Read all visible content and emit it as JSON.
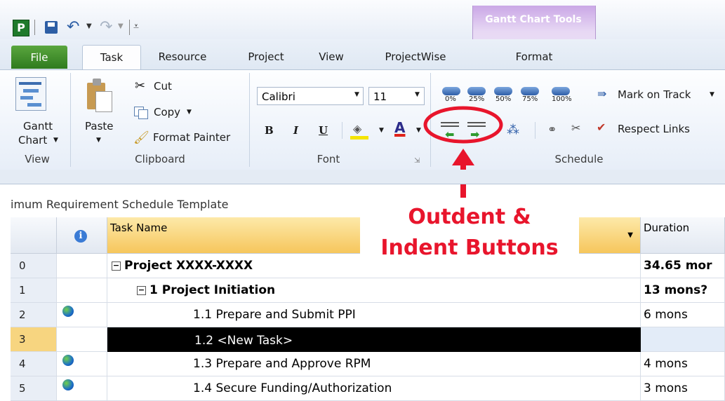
{
  "app_icon": "project-logo-icon",
  "contextual_tab": {
    "title": "Gantt Chart Tools",
    "tab": "Format"
  },
  "tabs": [
    "File",
    "Task",
    "Resource",
    "Project",
    "View",
    "ProjectWise"
  ],
  "ribbon": {
    "view": {
      "button": "Gantt",
      "button2": "Chart",
      "group": "View"
    },
    "clipboard": {
      "paste": "Paste",
      "cut": "Cut",
      "copy": "Copy",
      "format_painter": "Format Painter",
      "group": "Clipboard"
    },
    "font": {
      "family": "Calibri",
      "size": "11",
      "bold": "B",
      "italic": "I",
      "underline": "U",
      "font_color": "A",
      "group": "Font"
    },
    "schedule": {
      "pct": [
        "0%",
        "25%",
        "50%",
        "75%",
        "100%"
      ],
      "mark_on_track": "Mark on Track",
      "respect_links": "Respect Links",
      "group": "Schedule"
    }
  },
  "annotation": {
    "line1": "Outdent &",
    "line2": "Indent Buttons",
    "color": "#e8152c"
  },
  "view_title": "imum Requirement Schedule Template",
  "table": {
    "columns": {
      "task_name": "Task Name",
      "duration": "Duration"
    },
    "rows": [
      {
        "id": "0",
        "name": "Project XXXX-XXXX",
        "duration": "34.65 mor",
        "bold": true,
        "indent": 0,
        "collapse": true,
        "globe": false
      },
      {
        "id": "1",
        "name": "1 Project Initiation",
        "duration": "13 mons?",
        "bold": true,
        "indent": 1,
        "collapse": true,
        "globe": false
      },
      {
        "id": "2",
        "name": "1.1 Prepare and Submit PPI",
        "duration": "6 mons",
        "bold": false,
        "indent": 2,
        "collapse": false,
        "globe": true
      },
      {
        "id": "3",
        "name": "1.2 <New Task>",
        "duration": "",
        "bold": false,
        "indent": 2,
        "collapse": false,
        "globe": false,
        "selected": true
      },
      {
        "id": "4",
        "name": "1.3 Prepare and Approve RPM",
        "duration": "4 mons",
        "bold": false,
        "indent": 2,
        "collapse": false,
        "globe": true
      },
      {
        "id": "5",
        "name": "1.4 Secure Funding/Authorization",
        "duration": "3 mons",
        "bold": false,
        "indent": 2,
        "collapse": false,
        "globe": true
      }
    ]
  }
}
